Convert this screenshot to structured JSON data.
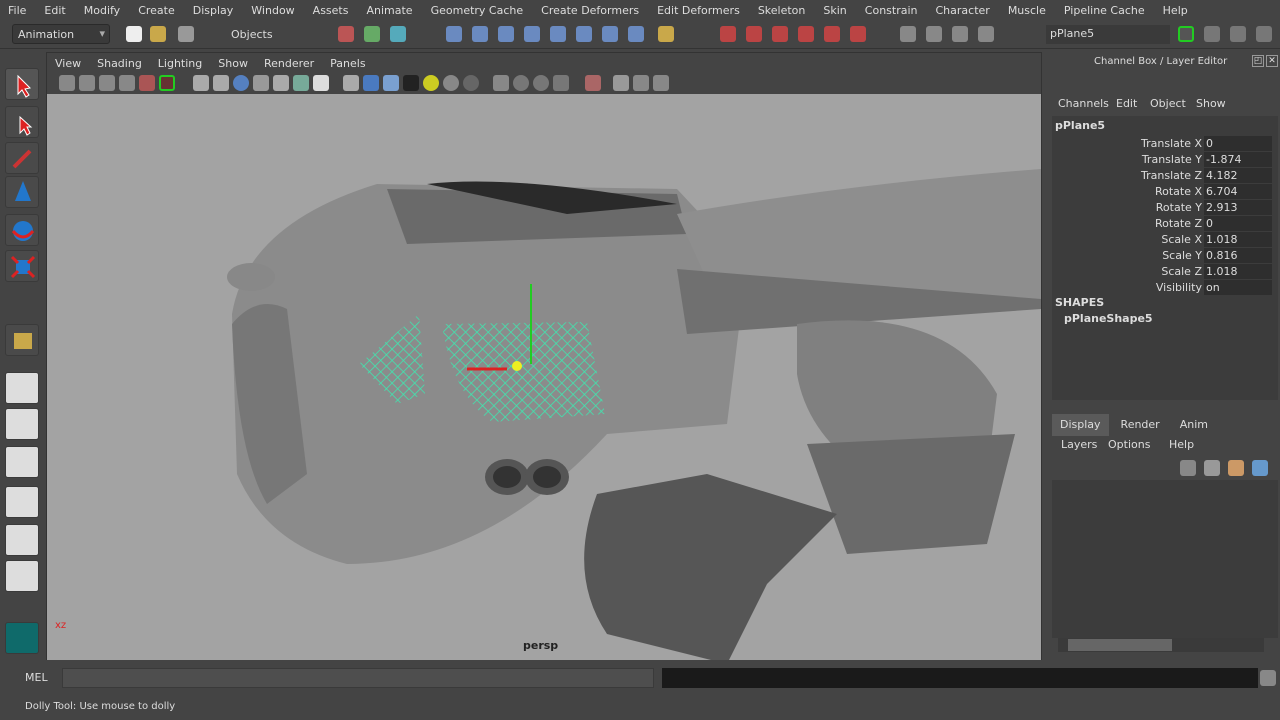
{
  "menubar": [
    "File",
    "Edit",
    "Modify",
    "Create",
    "Display",
    "Window",
    "Assets",
    "Animate",
    "Geometry Cache",
    "Create Deformers",
    "Edit Deformers",
    "Skeleton",
    "Skin",
    "Constrain",
    "Character",
    "Muscle",
    "Pipeline Cache",
    "Help"
  ],
  "toolbar": {
    "mode": "Animation",
    "selection_mode": "Objects",
    "object_name": "pPlane5"
  },
  "panel": {
    "menus": [
      "View",
      "Shading",
      "Lighting",
      "Show",
      "Renderer",
      "Panels"
    ],
    "camera": "persp",
    "axis_label": "xz"
  },
  "channel_box": {
    "title": "Channel Box / Layer Editor",
    "menus": [
      "Channels",
      "Edit",
      "Object",
      "Show"
    ],
    "object": "pPlane5",
    "channels": [
      {
        "label": "Translate X",
        "value": "0"
      },
      {
        "label": "Translate Y",
        "value": "-1.874"
      },
      {
        "label": "Translate Z",
        "value": "4.182"
      },
      {
        "label": "Rotate X",
        "value": "6.704"
      },
      {
        "label": "Rotate Y",
        "value": "2.913"
      },
      {
        "label": "Rotate Z",
        "value": "0"
      },
      {
        "label": "Scale X",
        "value": "1.018"
      },
      {
        "label": "Scale Y",
        "value": "0.816"
      },
      {
        "label": "Scale Z",
        "value": "1.018"
      },
      {
        "label": "Visibility",
        "value": "on"
      }
    ],
    "shapes_header": "SHAPES",
    "shape": "pPlaneShape5"
  },
  "layer_editor": {
    "tabs": [
      "Display",
      "Render",
      "Anim"
    ],
    "menus": [
      "Layers",
      "Options",
      "Help"
    ],
    "active_tab": "Display"
  },
  "command_line": {
    "label": "MEL",
    "value": ""
  },
  "help_line": "Dolly Tool: Use mouse to dolly",
  "colors": {
    "selection": "#3ee8b0",
    "viewport": "#a3a3a3",
    "panel": "#444444"
  }
}
